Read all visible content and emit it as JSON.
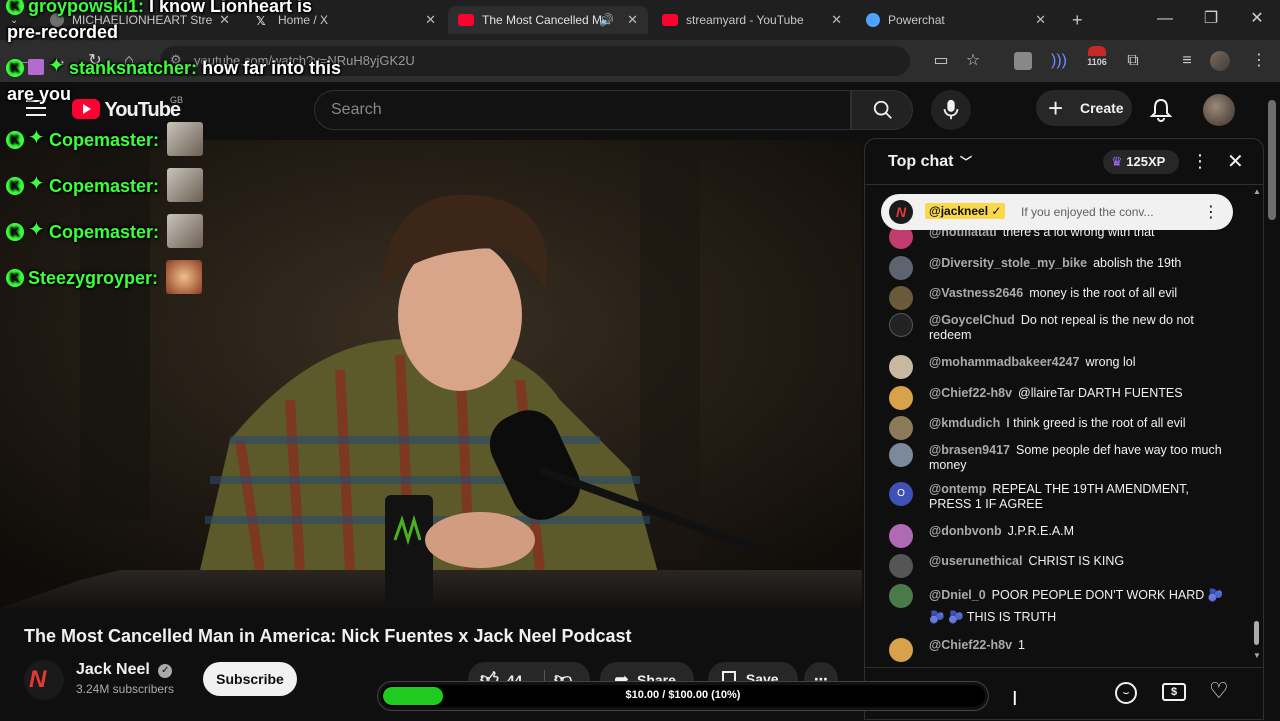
{
  "browser": {
    "tabs": [
      {
        "label": "MICHAELIONHEART Stre",
        "favicon_color": "#6f6f6f"
      },
      {
        "label": "Home / X",
        "favicon_color": "#e3e3e3"
      },
      {
        "label": "The Most Cancelled M",
        "favicon_color": "#ff0033"
      },
      {
        "label": "streamyard - YouTube",
        "favicon_color": "#ff0033"
      },
      {
        "label": "Powerchat",
        "favicon_color": "#4fa3ff"
      }
    ],
    "new_tab": "+",
    "url": "youtube.com/watch?v=NRuH8yjGK2U",
    "extension_count": "1106"
  },
  "youtube": {
    "logo_text": "YouTube",
    "region": "GB",
    "search_placeholder": "Search",
    "create_label": "Create"
  },
  "video": {
    "title": "The Most Cancelled Man in America: Nick Fuentes x Jack Neel Podcast",
    "channel_name": "Jack Neel",
    "subscribers": "3.24M subscribers",
    "subscribe_label": "Subscribe",
    "likes": "44",
    "share_label": "Share",
    "save_label": "Save"
  },
  "chat": {
    "mode_label": "Top chat",
    "xp_label": "125XP",
    "pinned": {
      "author": "@jackneel",
      "text": "If you enjoyed the conv..."
    },
    "messages": [
      {
        "author": "@hotlilatati",
        "text": "there's a lot wrong with that",
        "avatar_color": "#c23b6e"
      },
      {
        "author": "@Diversity_stole_my_bike",
        "text": "abolish the 19th",
        "avatar_color": "#5d6470"
      },
      {
        "author": "@Vastness2646",
        "text": "money is the root of all evil",
        "avatar_color": "#6a5a3a"
      },
      {
        "author": "@GoycelChud",
        "text": "Do not repeal is the new do not redeem",
        "avatar_color": "#222222"
      },
      {
        "author": "@mohammadbakeer4247",
        "text": "wrong lol",
        "avatar_color": "#c9b8a0"
      },
      {
        "author": "@Chief22-h8v",
        "text": "@llaireTar DARTH FUENTES",
        "avatar_color": "#d8a24a"
      },
      {
        "author": "@kmdudich",
        "text": "I think greed is the root of all evil",
        "avatar_color": "#8a7a5a"
      },
      {
        "author": "@brasen9417",
        "text": "Some people def have way too much money",
        "avatar_color": "#7a8a9a"
      },
      {
        "author": "@ontemp",
        "text": "REPEAL THE 19TH AMENDMENT, PRESS 1 IF AGREE",
        "avatar_color": "#3f51b5",
        "initial": "O"
      },
      {
        "author": "@donbvonb",
        "text": "J.P.R.E.A.M",
        "avatar_color": "#b06ab3"
      },
      {
        "author": "@userunethical",
        "text": "CHRIST IS KING",
        "avatar_color": "#555555"
      },
      {
        "author": "@Dniel_0",
        "text": "POOR PEOPLE DON'T WORK HARD 🫐 🫐 🫐 THIS IS TRUTH",
        "avatar_color": "#4a7a4a"
      },
      {
        "author": "@Chief22-h8v",
        "text": "1",
        "avatar_color": "#d8a24a"
      }
    ]
  },
  "overlay": {
    "lines": [
      {
        "name": "groypowski1:",
        "text": "I know Lionheart is"
      },
      {
        "name": "",
        "text": "pre-recorded"
      },
      {
        "name": "stanksnatcher:",
        "text": "how far into this"
      },
      {
        "name": "",
        "text": "are you"
      },
      {
        "name": "Copemaster:",
        "text": ""
      },
      {
        "name": "Copemaster:",
        "text": ""
      },
      {
        "name": "Copemaster:",
        "text": ""
      },
      {
        "name": "Steezygroyper:",
        "text": ""
      }
    ],
    "goal_text": "$10.00 / $100.00 (10%)",
    "goal_progress": 0.1
  },
  "colors": {
    "accent_green": "#3cff3c",
    "youtube_red": "#ff0033",
    "goal_green": "#1ecb1e"
  },
  "icons": [
    "menu-icon",
    "search-icon",
    "mic-icon",
    "bell-icon",
    "like-icon",
    "dislike-icon",
    "share-icon",
    "save-icon",
    "more-icon",
    "close-icon",
    "crown-icon",
    "emoji-icon",
    "superchat-icon",
    "heart-icon"
  ]
}
